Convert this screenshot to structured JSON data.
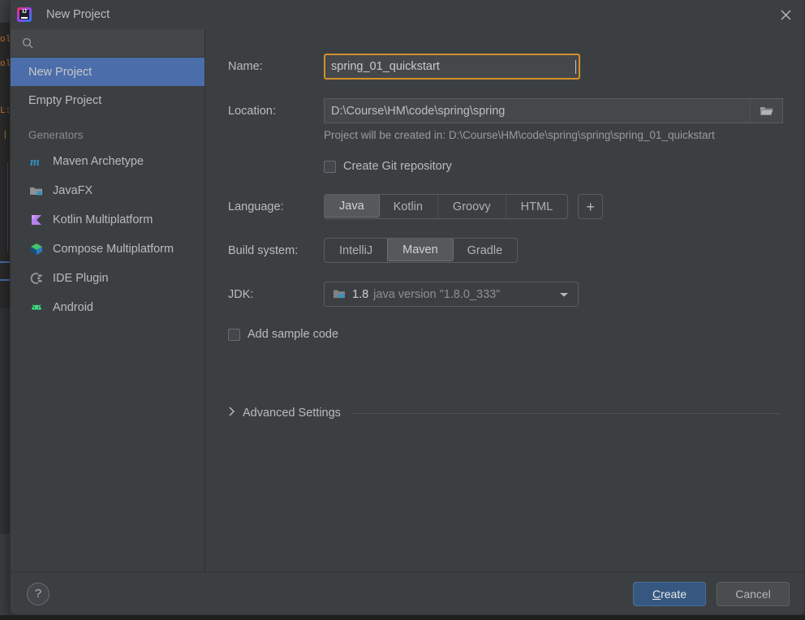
{
  "window": {
    "title": "New Project",
    "logo_icon": "intellij-idea-logo",
    "close_icon": "close-icon"
  },
  "sidebar": {
    "search": {
      "placeholder": "",
      "value": "",
      "icon": "search-icon"
    },
    "top_items": [
      {
        "label": "New Project",
        "selected": true
      },
      {
        "label": "Empty Project",
        "selected": false
      }
    ],
    "generators_header": "Generators",
    "generators": [
      {
        "label": "Maven Archetype",
        "icon": "maven-icon"
      },
      {
        "label": "JavaFX",
        "icon": "javafx-icon"
      },
      {
        "label": "Kotlin Multiplatform",
        "icon": "kotlin-multiplatform-icon"
      },
      {
        "label": "Compose Multiplatform",
        "icon": "compose-multiplatform-icon"
      },
      {
        "label": "IDE Plugin",
        "icon": "ide-plugin-icon"
      },
      {
        "label": "Android",
        "icon": "android-icon"
      }
    ]
  },
  "form": {
    "name": {
      "label": "Name:",
      "value": "spring_01_quickstart",
      "placeholder": "",
      "focused": true,
      "focus_color": "#d1912c"
    },
    "location": {
      "label": "Location:",
      "value": "D:\\Course\\HM\\code\\spring\\spring",
      "placeholder": "",
      "browse_icon": "folder-icon"
    },
    "location_hint": "Project will be created in: D:\\Course\\HM\\code\\spring\\spring\\spring_01_quickstart",
    "git": {
      "label": "Create Git repository",
      "checked": false
    },
    "language": {
      "label": "Language:",
      "options": [
        "Java",
        "Kotlin",
        "Groovy",
        "HTML"
      ],
      "selected": "Java",
      "add_button_icon": "plus-icon"
    },
    "build_system": {
      "label": "Build system:",
      "options": [
        "IntelliJ",
        "Maven",
        "Gradle"
      ],
      "selected": "Maven"
    },
    "jdk": {
      "label": "JDK:",
      "icon": "jdk-folder-icon",
      "version": "1.8",
      "description": "java version \"1.8.0_333\"",
      "dropdown_icon": "chevron-down-icon"
    },
    "sample_code": {
      "label": "Add sample code",
      "checked": false
    },
    "advanced_settings": {
      "label": "Advanced Settings",
      "expand_icon": "chevron-right-icon",
      "expanded": false
    }
  },
  "footer": {
    "help_label": "?",
    "create": {
      "label": "Create",
      "mnemonic": "C",
      "rest": "reate"
    },
    "cancel": {
      "label": "Cancel"
    }
  },
  "colors": {
    "dialog_bg": "#3c3f41",
    "selection_blue": "#4b6eab",
    "primary_button": "#365880",
    "focus_orange": "#d1912c"
  }
}
